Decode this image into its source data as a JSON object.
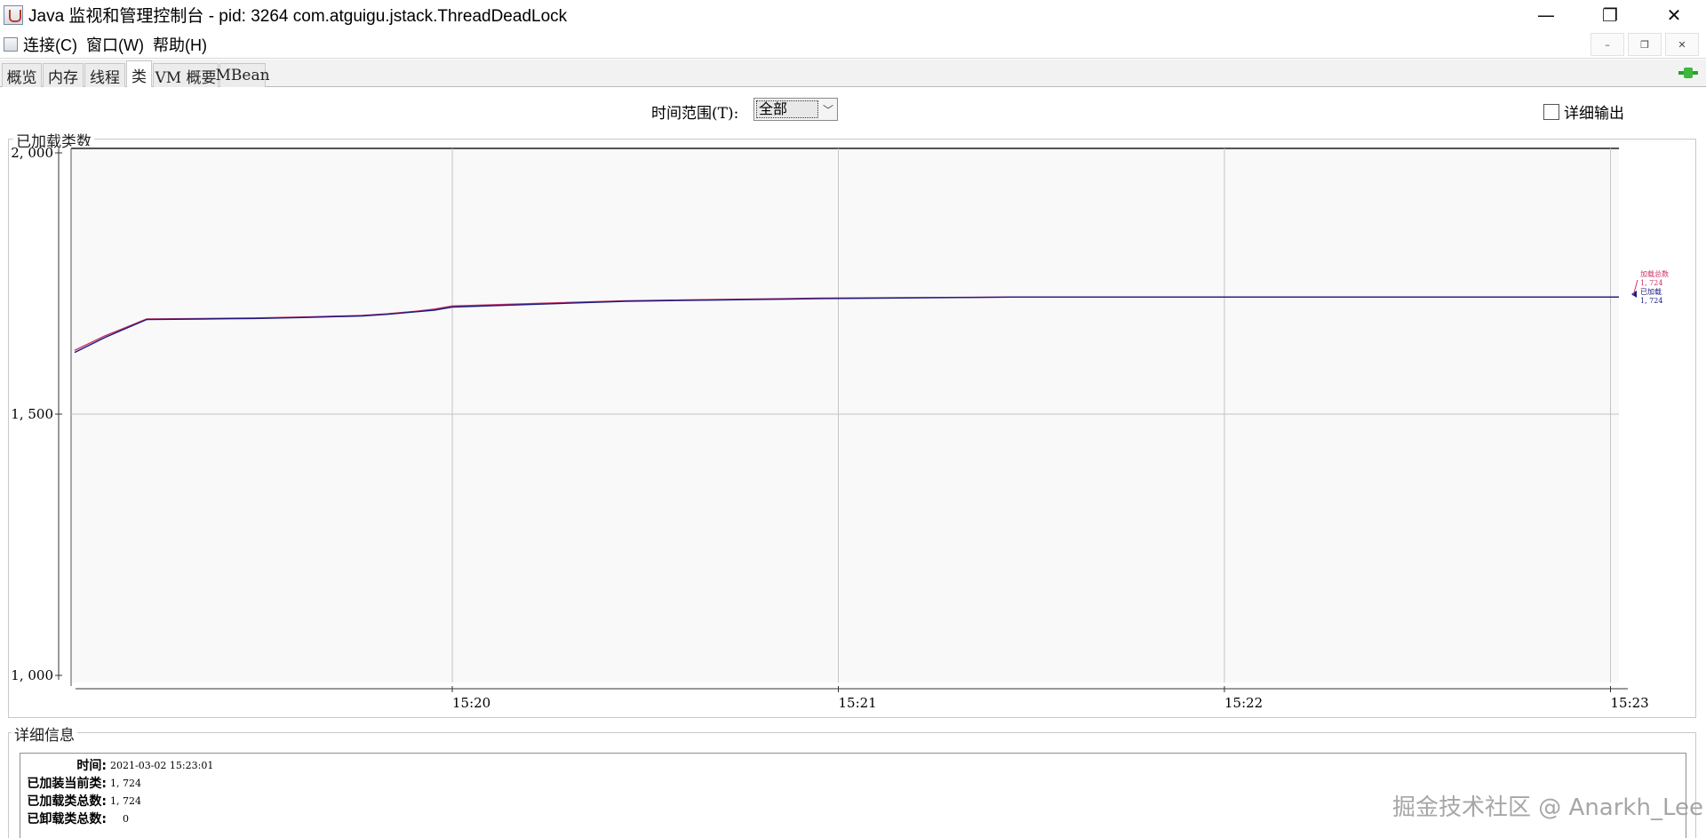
{
  "window": {
    "title": "Java 监视和管理控制台 - pid: 3264 com.atguigu.jstack.ThreadDeadLock",
    "minimize": "—",
    "maximize": "❐",
    "close": "✕"
  },
  "menubar": {
    "items": [
      "连接(C)",
      "窗口(W)",
      "帮助(H)"
    ],
    "inner_controls": [
      "–",
      "❐",
      "✕"
    ]
  },
  "tabs": [
    {
      "label": "概览",
      "active": false
    },
    {
      "label": "内存",
      "active": false
    },
    {
      "label": "线程",
      "active": false
    },
    {
      "label": "类",
      "active": true
    },
    {
      "label": "VM 概要",
      "active": false
    },
    {
      "label": "MBean",
      "active": false
    }
  ],
  "toolbar": {
    "time_range_label": "时间范围(T):",
    "time_range_value": "全部",
    "verbose_label": "详细输出",
    "verbose_checked": false
  },
  "chart_panel": {
    "title": "已加载类数"
  },
  "chart_data": {
    "type": "line",
    "ylim": [
      1000,
      2000
    ],
    "y_ticks": [
      "2, 000",
      "1, 500",
      "1, 000"
    ],
    "x_ticks": [
      "15:20",
      "15:21",
      "15:22",
      "15:23"
    ],
    "x_minutes": [
      0.0,
      0.085,
      0.2,
      0.35,
      0.5,
      0.65,
      0.8,
      0.87,
      0.95,
      1.0,
      1.05,
      1.5,
      2.0,
      2.5,
      3.0
    ],
    "series": [
      {
        "name": "加载总数",
        "color": "#cc3366",
        "values": [
          1622,
          1650,
          1682,
          1683,
          1684,
          1686,
          1689,
          1692,
          1697,
          1701,
          1707,
          1717,
          1722,
          1724,
          1724
        ]
      },
      {
        "name": "已加载",
        "color": "#1a1a80",
        "values": [
          1618,
          1647,
          1681,
          1682,
          1683,
          1685,
          1688,
          1691,
          1696,
          1699,
          1705,
          1716,
          1721,
          1724,
          1724
        ]
      }
    ],
    "legend": [
      {
        "name": "加载总数",
        "value": "1, 724",
        "color": "#cc3366"
      },
      {
        "name": "已加载",
        "value": "1, 724",
        "color": "#1a1a80"
      }
    ],
    "grid": true
  },
  "details_panel": {
    "title": "详细信息",
    "rows": [
      {
        "label": "时间:",
        "value": "2021-03-02 15:23:01"
      },
      {
        "label": "已加装当前类:",
        "value": "1, 724"
      },
      {
        "label": "已加载类总数:",
        "value": "1, 724"
      },
      {
        "label": "已卸载类总数:",
        "value": "0"
      }
    ]
  },
  "watermark": "掘金技术社区 @ Anarkh_Lee"
}
